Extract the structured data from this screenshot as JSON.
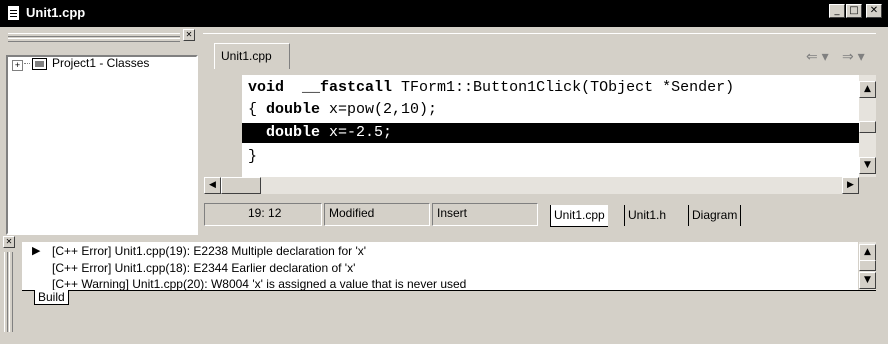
{
  "window": {
    "title": "Unit1.cpp",
    "min": "_",
    "max": "□",
    "close": "✕"
  },
  "tree": {
    "item_label": "Project1 - Classes",
    "expander": "⊞"
  },
  "editor": {
    "tab_label": "Unit1.cpp",
    "code_lines": [
      {
        "kw": "void",
        "rest": "  ",
        "kw2": "__fastcall",
        "tail": " TForm1::Button1Click(TObject *Sender)"
      },
      {
        "pre": "{ ",
        "kw": "double",
        "tail": " x=pow(2,10);"
      },
      {
        "pre": "  ",
        "kw": "double",
        "tail": " x=-2.5;"
      },
      {
        "pre": "}",
        "kw": "",
        "tail": ""
      }
    ]
  },
  "status": {
    "position": "19: 12",
    "modified": "Modified",
    "mode": "Insert"
  },
  "file_tabs": [
    "Unit1.cpp",
    "Unit1.h",
    "Diagram"
  ],
  "messages": [
    "[C++ Error] Unit1.cpp(19): E2238 Multiple declaration for 'x'",
    "[C++ Error] Unit1.cpp(18): E2344 Earlier declaration of 'x'",
    "[C++ Warning] Unit1.cpp(20): W8004 'x' is assigned a value that is never used"
  ],
  "message_tabs": [
    "Build"
  ]
}
